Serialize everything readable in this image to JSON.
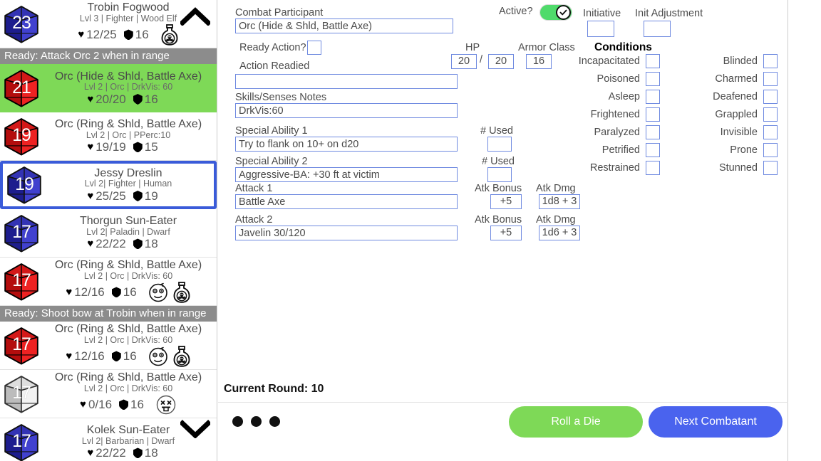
{
  "sidebar": {
    "scroll_up_icon": "chevron-up-icon",
    "scroll_down_icon": "chevron-down-icon",
    "combatants": [
      {
        "init": "23",
        "die_color": "#3b3bbf",
        "die_style": "blue",
        "name": "Trobin Fogwood",
        "sub": "Lvl 3 | Fighter | Wood Elf",
        "hp": "12/25",
        "ac": "16",
        "status_icons": [
          "poison-bottle-icon"
        ],
        "active": false,
        "selected": false,
        "ready_banner": "Ready: Attack Orc 2 when in range"
      },
      {
        "init": "21",
        "die_color": "#e02020",
        "die_style": "red",
        "name": "Orc (Hide & Shld, Battle Axe)",
        "sub": "Lvl 2 | Orc | DrkVis: 60",
        "hp": "20/20",
        "ac": "16",
        "status_icons": [],
        "active": true,
        "selected": false,
        "ready_banner": ""
      },
      {
        "init": "19",
        "die_color": "#e02020",
        "die_style": "red",
        "name": "Orc (Ring & Shld, Battle Axe)",
        "sub": "Lvl 2 | Orc | PPerc:10",
        "hp": "19/19",
        "ac": "15",
        "status_icons": [],
        "active": false,
        "selected": false,
        "ready_banner": ""
      },
      {
        "init": "19",
        "die_color": "#3b3bbf",
        "die_style": "blue",
        "name": "Jessy Dreslin",
        "sub": "Lvl 2| Fighter | Human",
        "hp": "25/25",
        "ac": "19",
        "status_icons": [],
        "active": false,
        "selected": true,
        "ready_banner": ""
      },
      {
        "init": "17",
        "die_color": "#3b3bbf",
        "die_style": "blue",
        "name": "Thorgun Sun-Eater",
        "sub": "Lvl 2| Paladin | Dwarf",
        "hp": "22/22",
        "ac": "18",
        "status_icons": [],
        "active": false,
        "selected": false,
        "ready_banner": ""
      },
      {
        "init": "17",
        "die_color": "#e02020",
        "die_style": "red",
        "name": "Orc (Ring & Shld, Battle Axe)",
        "sub": "Lvl 2 | Orc | DrkVis: 60",
        "hp": "12/16",
        "ac": "16",
        "status_icons": [
          "dizzy-face-icon",
          "poison-bottle-icon"
        ],
        "active": false,
        "selected": false,
        "ready_banner": "Ready: Shoot bow at Trobin when in range"
      },
      {
        "init": "17",
        "die_color": "#e02020",
        "die_style": "red",
        "name": "Orc (Ring & Shld, Battle Axe)",
        "sub": "Lvl 2 | Orc | DrkVis: 60",
        "hp": "12/16",
        "ac": "16",
        "status_icons": [
          "dizzy-face-icon",
          "poison-bottle-icon"
        ],
        "active": false,
        "selected": false,
        "ready_banner": ""
      },
      {
        "init": "17",
        "die_color": "#d8d8d8",
        "die_style": "grey",
        "name": "Orc (Ring & Shld, Battle Axe)",
        "sub": "Lvl 2 | Orc | DrkVis: 60",
        "hp": "0/16",
        "ac": "16",
        "status_icons": [
          "dead-face-icon"
        ],
        "active": false,
        "selected": false,
        "ready_banner": ""
      },
      {
        "init": "17",
        "die_color": "#3b3bbf",
        "die_style": "blue",
        "name": "Kolek Sun-Eater",
        "sub": "Lvl 2| Barbarian | Dwarf",
        "hp": "22/22",
        "ac": "18",
        "status_icons": [],
        "active": false,
        "selected": false,
        "ready_banner": ""
      }
    ]
  },
  "form": {
    "participant_label": "Combat Participant",
    "participant_value": "Orc (Hide & Shld, Battle Axe)",
    "ready_action_label": "Ready Action?",
    "ready_action_checked": false,
    "action_readied_label": "Action Readied",
    "action_readied_value": "",
    "skills_label": "Skills/Senses Notes",
    "skills_value": "DrkVis:60",
    "special1_label": "Special Ability 1",
    "special1_value": "Try to flank on 10+ on d20",
    "special1_used_label": "# Used",
    "special1_used_value": "",
    "special2_label": "Special Ability 2",
    "special2_value": "Aggressive-BA: +30 ft at victim",
    "special2_used_label": "# Used",
    "special2_used_value": "",
    "attack1_label": "Attack 1",
    "attack1_value": "Battle Axe",
    "attack1_bonus_label": "Atk Bonus",
    "attack1_bonus_value": "+5",
    "attack1_dmg_label": "Atk Dmg",
    "attack1_dmg_value": "1d8 + 3",
    "attack2_label": "Attack 2",
    "attack2_value": "Javelin 30/120",
    "attack2_bonus_label": "Atk Bonus",
    "attack2_bonus_value": "+5",
    "attack2_dmg_label": "Atk Dmg",
    "attack2_dmg_value": "1d6 + 3",
    "active_label": "Active?",
    "active_on": true,
    "initiative_label": "Initiative",
    "initiative_value": "",
    "init_adjust_label": "Init Adjustment",
    "init_adjust_value": "",
    "hp_label": "HP",
    "hp_current": "20",
    "hp_separator": "/",
    "hp_max": "20",
    "ac_label": "Armor Class",
    "ac_value": "16"
  },
  "conditions": {
    "title": "Conditions",
    "left": [
      {
        "label": "Incapacitated",
        "checked": false
      },
      {
        "label": "Poisoned",
        "checked": false
      },
      {
        "label": "Asleep",
        "checked": false
      },
      {
        "label": "Frightened",
        "checked": false
      },
      {
        "label": "Paralyzed",
        "checked": false
      },
      {
        "label": "Petrified",
        "checked": false
      },
      {
        "label": "Restrained",
        "checked": false
      }
    ],
    "right": [
      {
        "label": "Blinded",
        "checked": false
      },
      {
        "label": "Charmed",
        "checked": false
      },
      {
        "label": "Deafened",
        "checked": false
      },
      {
        "label": "Grappled",
        "checked": false
      },
      {
        "label": "Invisible",
        "checked": false
      },
      {
        "label": "Prone",
        "checked": false
      },
      {
        "label": "Stunned",
        "checked": false
      }
    ]
  },
  "footer": {
    "round_text": "Current Round: 10",
    "roll_die_label": "Roll a Die",
    "next_combatant_label": "Next Combatant",
    "menu_icon": "three-dots-icon"
  },
  "colors": {
    "accent_green": "#7ed957",
    "accent_blue": "#4a63ee",
    "selected_border": "#3a5bd9",
    "banner_grey": "#8c8c8c",
    "input_border": "#6f8ae0"
  }
}
